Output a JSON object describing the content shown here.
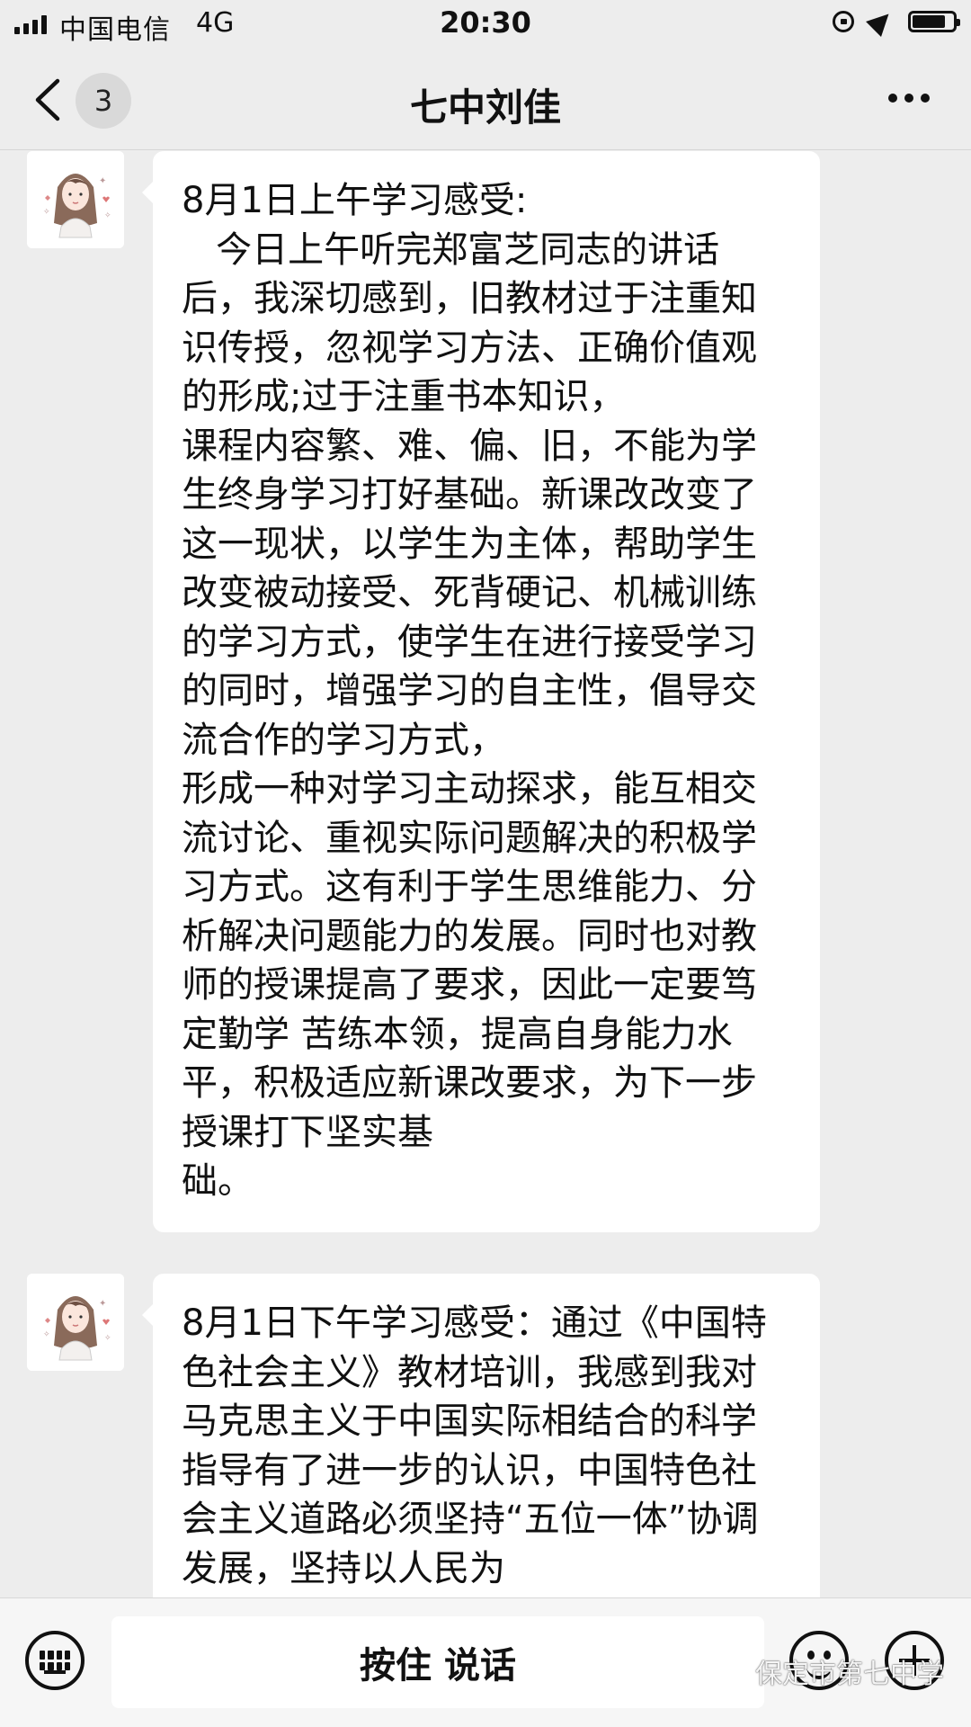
{
  "status_bar": {
    "carrier": "中国电信",
    "network": "4G",
    "time": "20:30",
    "icons": [
      "signal-icon",
      "rotation-lock-icon",
      "location-icon",
      "battery-icon"
    ]
  },
  "nav": {
    "back_icon": "chevron-left-icon",
    "unread_count": "3",
    "title": "七中刘佳",
    "more_icon": "more-dots-icon"
  },
  "messages": [
    {
      "sender_avatar": "avatar-illustration-girl",
      "text": "8月1日上午学习感受:\n   今日上午听完郑富芝同志的讲话后，我深切感到，旧教材过于注重知识传授，忽视学习方法、正确价值观的形成;过于注重书本知识，\n课程内容繁、难、偏、旧，不能为学生终身学习打好基础。新课改改变了这一现状，以学生为主体，帮助学生改变被动接受、死背硬记、机械训练的学习方式，使学生在进行接受学习的同时，增强学习的自主性，倡导交流合作的学习方式，\n形成一种对学习主动探求，能互相交流讨论、重视实际问题解决的积极学习方式。这有利于学生思维能力、分析解决问题能力的发展。同时也对教师的授课提高了要求，因此一定要笃定勤学 苦练本领，提高自身能力水平，积极适应新课改要求，为下一步授课打下坚实基\n础。"
    },
    {
      "sender_avatar": "avatar-illustration-girl",
      "text": "8月1日下午学习感受：通过《中国特色社会主义》教材培训，我感到我对马克思主义于中国实际相结合的科学指导有了进一步的认识，中国特色社会主义道路必须坚持“五位一体”协调发展，坚持以人民为"
    }
  ],
  "input_bar": {
    "keyboard_icon": "keyboard-icon",
    "voice_label": "按住 说话",
    "emoji_icon": "emoji-icon",
    "plus_icon": "plus-icon"
  },
  "watermark": {
    "text": "保定市第七中学",
    "icon": "wechat-logo-icon"
  },
  "colors": {
    "background": "#ededed",
    "bubble": "#ffffff",
    "input_bar": "#f6f6f6"
  }
}
